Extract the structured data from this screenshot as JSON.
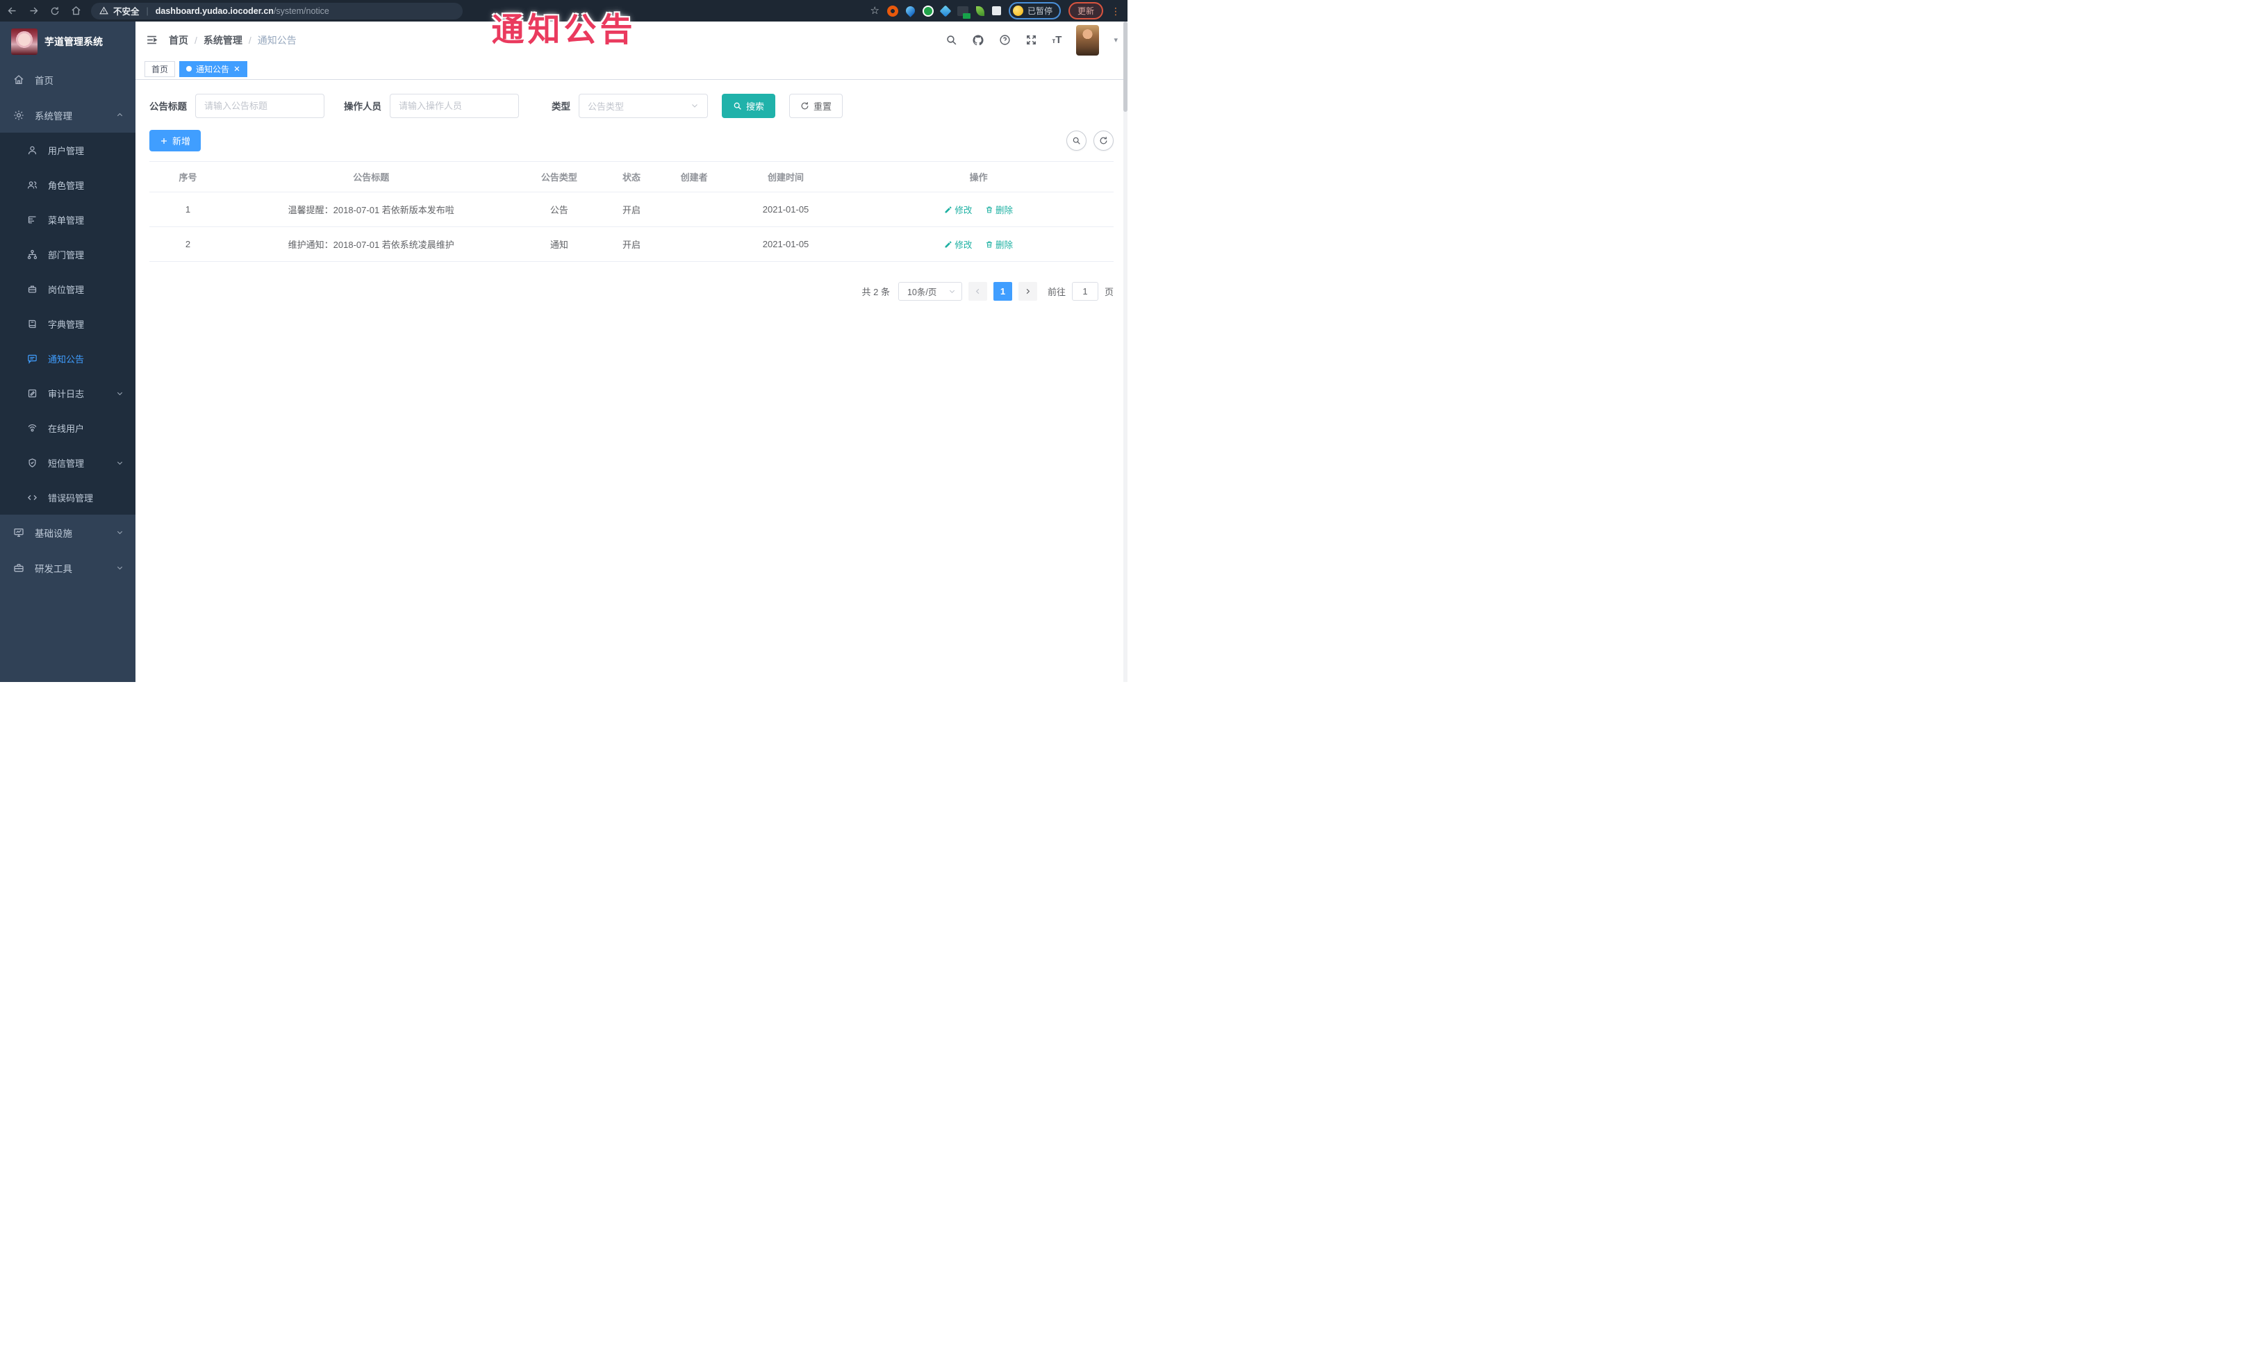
{
  "browser": {
    "security_label": "不安全",
    "url_host": "dashboard.yudao.iocoder.cn",
    "url_path": "/system/notice",
    "paused_label": "已暂停",
    "update_label": "更新"
  },
  "overlay": {
    "title": "通知公告"
  },
  "sidebar": {
    "logo_title": "芋道管理系统",
    "menu": [
      {
        "label": "首页",
        "icon": "home-icon"
      },
      {
        "label": "系统管理",
        "icon": "gear-icon",
        "state": "expanded"
      },
      {
        "label": "用户管理",
        "icon": "user-icon"
      },
      {
        "label": "角色管理",
        "icon": "peoples-icon"
      },
      {
        "label": "菜单管理",
        "icon": "tree-table-icon"
      },
      {
        "label": "部门管理",
        "icon": "org-tree-icon"
      },
      {
        "label": "岗位管理",
        "icon": "post-icon"
      },
      {
        "label": "字典管理",
        "icon": "dict-icon"
      },
      {
        "label": "通知公告",
        "icon": "message-icon",
        "state": "active"
      },
      {
        "label": "审计日志",
        "icon": "log-icon",
        "state": "collapsed"
      },
      {
        "label": "在线用户",
        "icon": "online-icon"
      },
      {
        "label": "短信管理",
        "icon": "sms-icon",
        "state": "collapsed"
      },
      {
        "label": "错误码管理",
        "icon": "code-icon"
      },
      {
        "label": "基础设施",
        "icon": "monitor-icon",
        "state": "collapsed"
      },
      {
        "label": "研发工具",
        "icon": "tool-icon",
        "state": "collapsed"
      }
    ]
  },
  "header": {
    "breadcrumb": [
      "首页",
      "系统管理",
      "通知公告"
    ],
    "separator": "/"
  },
  "tabs": [
    {
      "label": "首页",
      "active": false
    },
    {
      "label": "通知公告",
      "active": true
    }
  ],
  "filters": {
    "title_label": "公告标题",
    "title_placeholder": "请输入公告标题",
    "operator_label": "操作人员",
    "operator_placeholder": "请输入操作人员",
    "type_label": "类型",
    "type_placeholder": "公告类型",
    "search_label": "搜索",
    "reset_label": "重置"
  },
  "toolbar": {
    "add_label": "新增"
  },
  "table": {
    "columns": [
      "序号",
      "公告标题",
      "公告类型",
      "状态",
      "创建者",
      "创建时间",
      "操作"
    ],
    "rows": [
      {
        "no": "1",
        "title": "温馨提醒：2018-07-01 若依新版本发布啦",
        "type": "公告",
        "status": "开启",
        "creator": "",
        "created": "2021-01-05"
      },
      {
        "no": "2",
        "title": "维护通知：2018-07-01 若依系统凌晨维护",
        "type": "通知",
        "status": "开启",
        "creator": "",
        "created": "2021-01-05"
      }
    ],
    "edit_label": "修改",
    "delete_label": "删除"
  },
  "pagination": {
    "total_label": "共 2 条",
    "page_size_label": "10条/页",
    "current_page": "1",
    "goto_label": "前往",
    "goto_value": "1",
    "page_unit": "页"
  },
  "colors": {
    "accent_blue": "#409EFF",
    "accent_teal": "#20B2AA",
    "overlay_red": "#EA3A5E",
    "sidebar_bg": "#304156",
    "submenu_bg": "#1F2D3D",
    "browser_bar_bg": "#1D2733"
  }
}
